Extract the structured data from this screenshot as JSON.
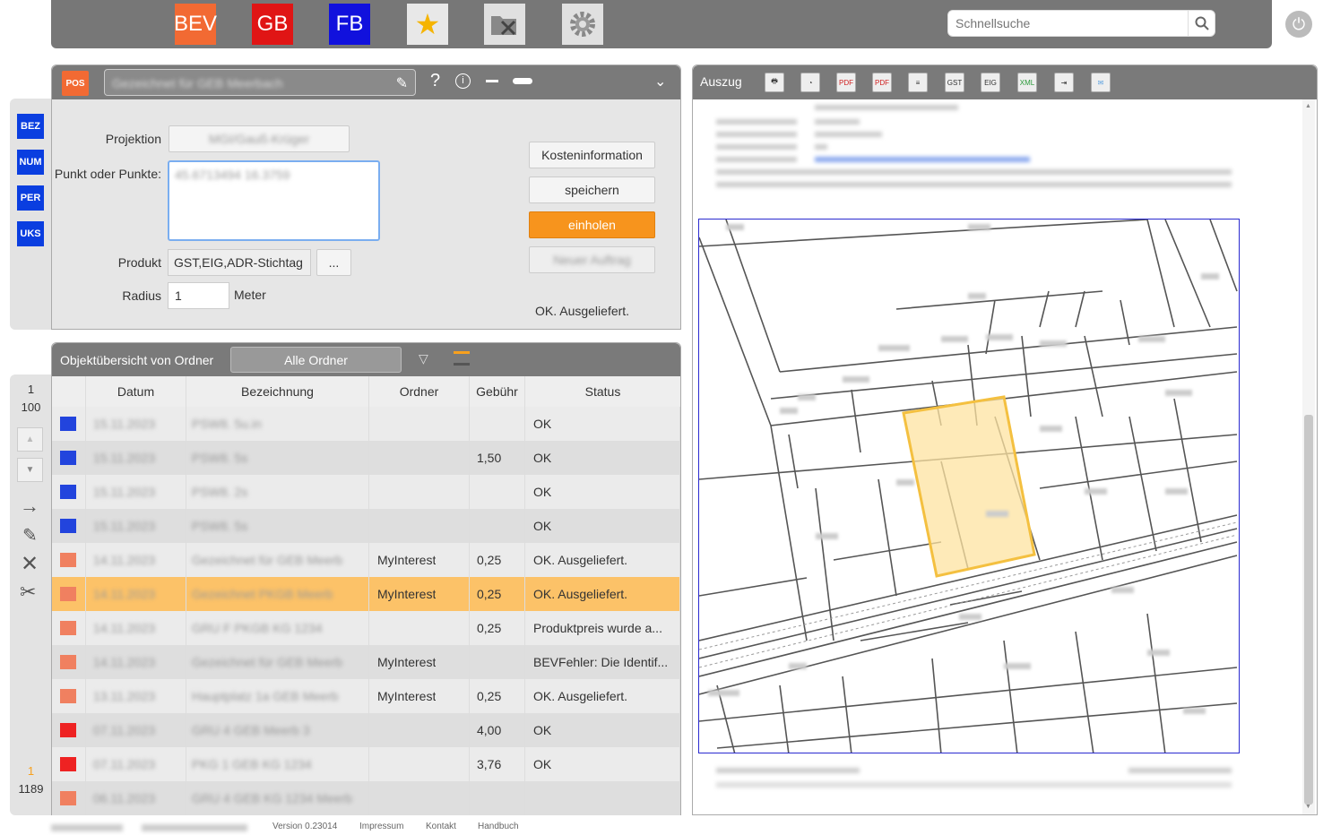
{
  "topbar": {
    "apps": [
      {
        "label": "BEV",
        "color": "#f26a33"
      },
      {
        "label": "GB",
        "color": "#e01515"
      },
      {
        "label": "FB",
        "color": "#1111dd"
      }
    ],
    "search_placeholder": "Schnellsuche"
  },
  "form": {
    "pos_badge": "POS",
    "title_value": "Gezeichnet für GEB Meerbach",
    "side_buttons": [
      "BEZ",
      "NUM",
      "PER",
      "UKS"
    ],
    "projektion_label": "Projektion",
    "projektion_value": "MGI/Gauß-Krüger",
    "punkte_label": "Punkt oder Punkte:",
    "punkte_value": "45.6713494 16.3759",
    "produkt_label": "Produkt",
    "produkt_value": "GST,EIG,ADR-Stichtag",
    "produkt_more": "...",
    "radius_label": "Radius",
    "radius_value": "1",
    "radius_unit": "Meter",
    "btn_kosten": "Kosteninformation",
    "btn_speichern": "speichern",
    "btn_einholen": "einholen",
    "btn_disabled": "Neuer Auftrag",
    "status": "OK. Ausgeliefert."
  },
  "list": {
    "title": "Objektübersicht von Ordner",
    "folder_button": "Alle Ordner",
    "pager_top_a": "1",
    "pager_top_b": "100",
    "pager_bottom_a": "1",
    "pager_bottom_b": "1189",
    "columns": [
      "Datum",
      "Bezeichnung",
      "Ordner",
      "Gebühr",
      "Status"
    ],
    "rows": [
      {
        "datum": "15.11.2023",
        "bez": "PSW8. 5u.in",
        "ordner": "",
        "gebuehr": "",
        "status": "OK",
        "icon": "#2244dd",
        "bg": "#ebebeb"
      },
      {
        "datum": "15.11.2023",
        "bez": "PSW8. 5s",
        "ordner": "",
        "gebuehr": "1,50",
        "status": "OK",
        "icon": "#2244dd",
        "bg": "#dedede"
      },
      {
        "datum": "15.11.2023",
        "bez": "PSW8. 2s",
        "ordner": "",
        "gebuehr": "",
        "status": "OK",
        "icon": "#2244dd",
        "bg": "#ebebeb"
      },
      {
        "datum": "15.11.2023",
        "bez": "PSW8. 5s",
        "ordner": "",
        "gebuehr": "",
        "status": "OK",
        "icon": "#2244dd",
        "bg": "#dedede"
      },
      {
        "datum": "14.11.2023",
        "bez": "Gezeichnet für GEB Meerb",
        "ordner": "MyInterest",
        "gebuehr": "0,25",
        "status": "OK. Ausgeliefert.",
        "icon": "#f08060",
        "bg": "#ebebeb"
      },
      {
        "datum": "14.11.2023",
        "bez": "Gezeichnet PKGB Meerb",
        "ordner": "MyInterest",
        "gebuehr": "0,25",
        "status": "OK. Ausgeliefert.",
        "icon": "#f08060",
        "bg": "#fcc268"
      },
      {
        "datum": "14.11.2023",
        "bez": "GRU F PKGB KG 1234",
        "ordner": "",
        "gebuehr": "0,25",
        "status": "Produktpreis wurde a...",
        "icon": "#f08060",
        "bg": "#ebebeb"
      },
      {
        "datum": "14.11.2023",
        "bez": "Gezeichnet für GEB Meerb",
        "ordner": "MyInterest",
        "gebuehr": "",
        "status": "BEVFehler: Die Identif...",
        "icon": "#f08060",
        "bg": "#dedede"
      },
      {
        "datum": "13.11.2023",
        "bez": "Hauptplatz 1a GEB Meerb",
        "ordner": "MyInterest",
        "gebuehr": "0,25",
        "status": "OK. Ausgeliefert.",
        "icon": "#f08060",
        "bg": "#ebebeb"
      },
      {
        "datum": "07.11.2023",
        "bez": "GRU 4 GEB Meerb 3",
        "ordner": "",
        "gebuehr": "4,00",
        "status": "OK",
        "icon": "#ee2222",
        "bg": "#dedede"
      },
      {
        "datum": "07.11.2023",
        "bez": "PKG 1 GEB KG 1234",
        "ordner": "",
        "gebuehr": "3,76",
        "status": "OK",
        "icon": "#ee2222",
        "bg": "#ebebeb"
      },
      {
        "datum": "06.11.2023",
        "bez": "GRU 4 GEB KG 1234 Meerb",
        "ordner": "",
        "gebuehr": "",
        "status": "",
        "icon": "#f08060",
        "bg": "#dedede"
      }
    ]
  },
  "auszug": {
    "title": "Auszug",
    "tool_labels": [
      "PDF",
      "PDF",
      "GST",
      "EIG",
      "XML"
    ]
  },
  "footer": {
    "links": [
      "Version 0.23014",
      "Impressum",
      "Kontakt",
      "Handbuch"
    ]
  }
}
